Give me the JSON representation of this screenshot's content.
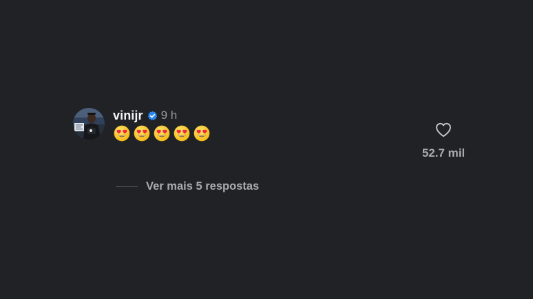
{
  "comment": {
    "username": "vinijr",
    "verified": true,
    "timestamp": "9 h",
    "emoji_count": 5,
    "emoji_type": "smiling-face-with-heart-eyes",
    "likes": "52.7 mil",
    "view_replies": "Ver mais 5 respostas"
  },
  "icons": {
    "verified": "verified-badge-icon",
    "like": "heart-outline-icon",
    "emoji": "heart-eyes-emoji-icon"
  },
  "colors": {
    "background": "#212226",
    "username": "#f5f5f5",
    "muted": "#a9aaae",
    "verified": "#2b87f0"
  }
}
